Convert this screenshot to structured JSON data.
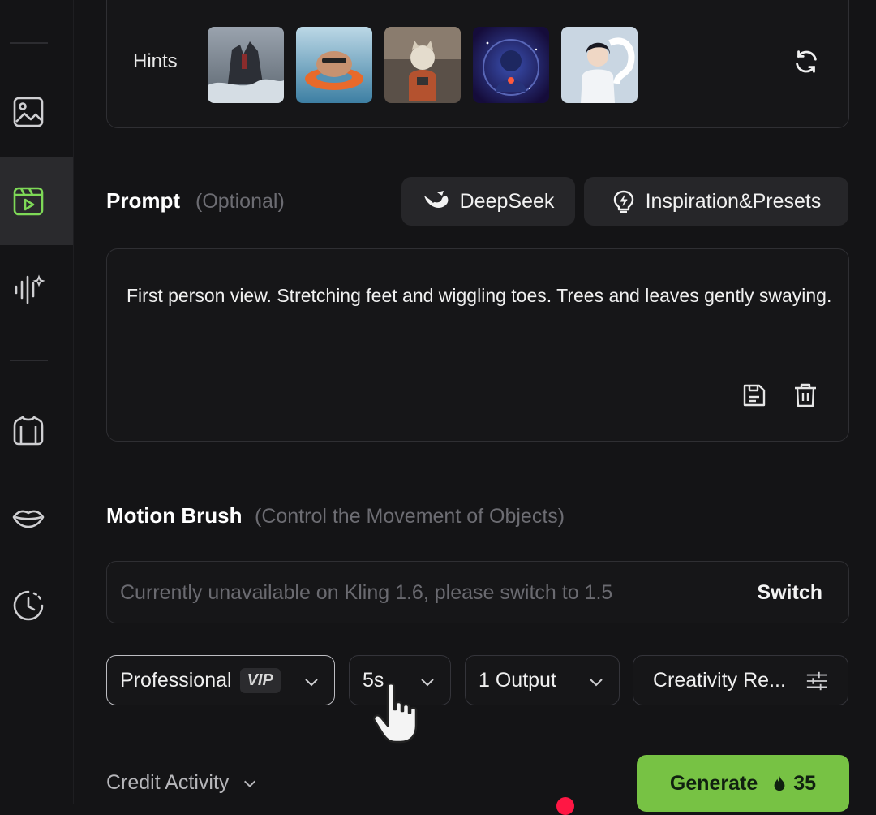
{
  "sidebar": {
    "items": [
      {
        "name": "image",
        "icon": "image-icon"
      },
      {
        "name": "video",
        "icon": "video-icon",
        "active": true
      },
      {
        "name": "audio",
        "icon": "audio-wave-icon"
      },
      {
        "name": "outfit",
        "icon": "shirt-icon"
      },
      {
        "name": "lip-sync",
        "icon": "lips-icon"
      },
      {
        "name": "history",
        "icon": "history-clock-icon"
      }
    ],
    "accent_color": "#7ed957"
  },
  "hints": {
    "label": "Hints",
    "thumbnails": [
      "stormy-tower-thumb",
      "capybara-float-thumb",
      "cat-astronaut-thumb",
      "space-astronaut-thumb",
      "anime-character-thumb"
    ],
    "refresh_icon": "refresh-icon"
  },
  "prompt": {
    "title": "Prompt",
    "optional": "(Optional)",
    "deepseek_label": "DeepSeek",
    "inspiration_label": "Inspiration&Presets",
    "text": "First person view. Stretching feet and wiggling toes. Trees and leaves gently swaying."
  },
  "motion_brush": {
    "title": "Motion Brush",
    "subtitle": "(Control the Movement of Objects)",
    "placeholder": "Currently unavailable on Kling 1.6, please switch to 1.5",
    "switch_label": "Switch"
  },
  "settings": {
    "mode": "Professional",
    "vip_badge": "VIP",
    "duration": "5s",
    "outputs": "1 Output",
    "creativity": "Creativity Re..."
  },
  "footer": {
    "credit_activity": "Credit Activity",
    "generate_label": "Generate",
    "cost": "35",
    "generate_color": "#77c244"
  }
}
